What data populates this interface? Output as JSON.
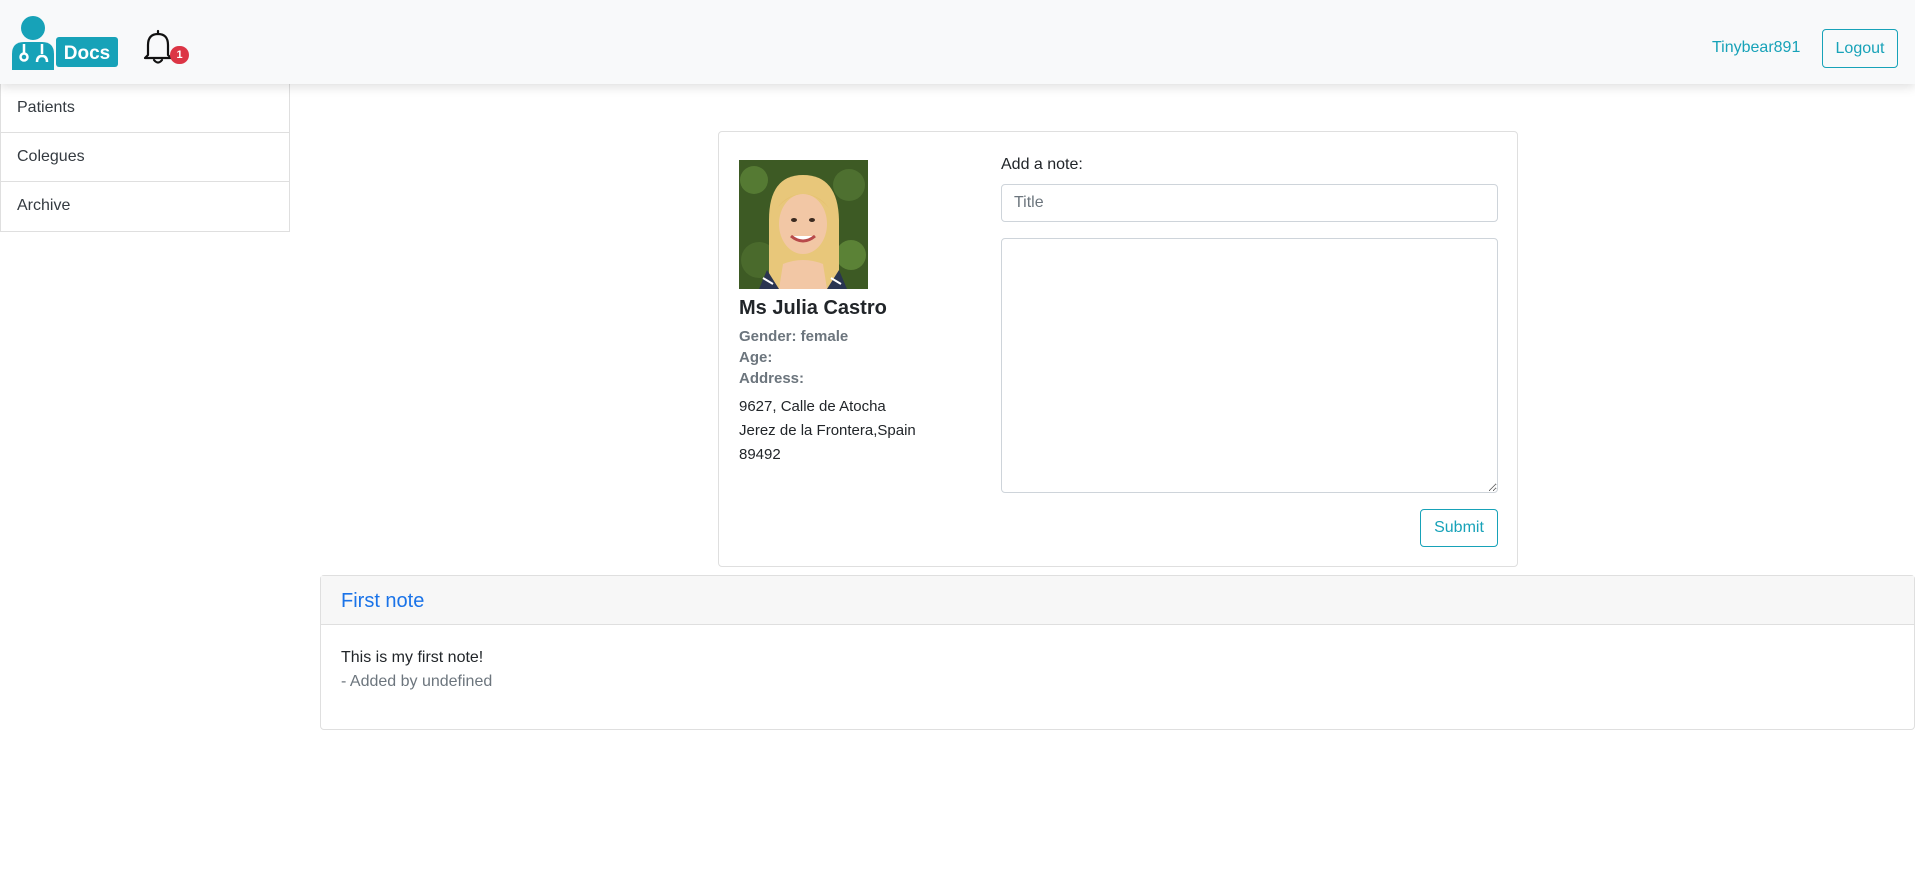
{
  "header": {
    "logo_text": "Docs",
    "notification_count": "1",
    "username": "Tinybear891",
    "logout_label": "Logout",
    "accent_color": "#17a2b8",
    "badge_color": "#dc3545"
  },
  "sidebar": {
    "items": [
      {
        "label": "Patients"
      },
      {
        "label": "Colegues"
      },
      {
        "label": "Archive"
      }
    ]
  },
  "patient": {
    "name": "Ms Julia Castro",
    "gender": "Gender: female",
    "age": "Age:",
    "address_label": "Address:",
    "address_lines": [
      "9627, Calle de Atocha",
      "Jerez de la Frontera,Spain",
      "89492"
    ]
  },
  "note_form": {
    "label": "Add a note:",
    "title_placeholder": "Title",
    "title_value": "",
    "body_value": "",
    "submit_label": "Submit"
  },
  "notes": [
    {
      "title": "First note",
      "text": "This is my first note!",
      "author": "- Added by undefined"
    }
  ]
}
